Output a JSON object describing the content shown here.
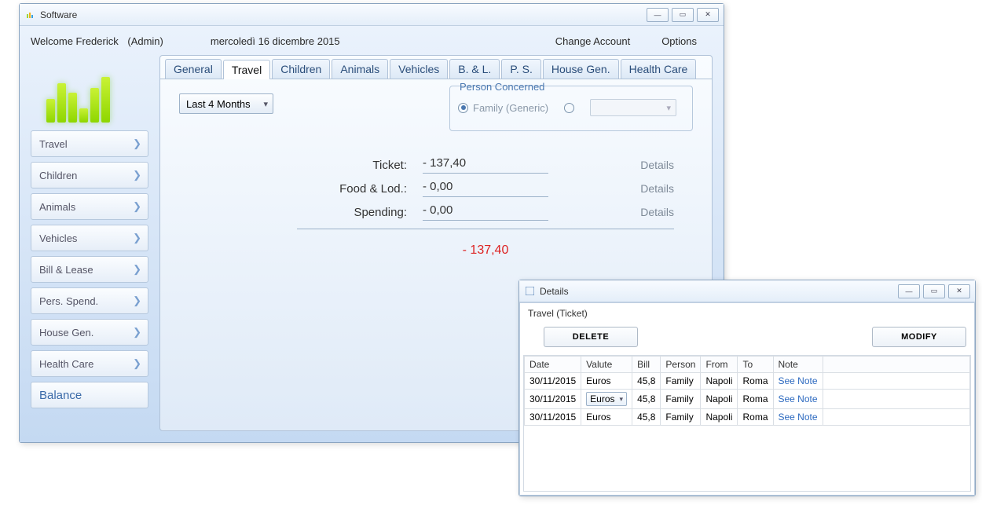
{
  "main_window": {
    "title": "Software",
    "welcome": "Welcome Frederick",
    "role": "(Admin)",
    "date": "mercoledì 16 dicembre 2015",
    "change_account": "Change Account",
    "options": "Options"
  },
  "sidebar": {
    "items": [
      {
        "label": "Travel"
      },
      {
        "label": "Children"
      },
      {
        "label": "Animals"
      },
      {
        "label": "Vehicles"
      },
      {
        "label": "Bill & Lease"
      },
      {
        "label": "Pers. Spend."
      },
      {
        "label": "House Gen."
      },
      {
        "label": "Health Care"
      }
    ],
    "balance": "Balance"
  },
  "tabs": [
    {
      "label": "General"
    },
    {
      "label": "Travel"
    },
    {
      "label": "Children"
    },
    {
      "label": "Animals"
    },
    {
      "label": "Vehicles"
    },
    {
      "label": "B. & L."
    },
    {
      "label": "P. S."
    },
    {
      "label": "House Gen."
    },
    {
      "label": "Health Care"
    }
  ],
  "panel": {
    "period": "Last 4 Months",
    "person_legend": "Person Concerned",
    "radio_family": "Family (Generic)",
    "rows": [
      {
        "label": "Ticket:",
        "amount": "- 137,40",
        "details": "Details"
      },
      {
        "label": "Food & Lod.:",
        "amount": "- 0,00",
        "details": "Details"
      },
      {
        "label": "Spending:",
        "amount": "- 0,00",
        "details": "Details"
      }
    ],
    "total": "- 137,40"
  },
  "details_window": {
    "title": "Details",
    "subtitle": "Travel  (Ticket)",
    "delete": "DELETE",
    "modify": "MODIFY",
    "columns": [
      "Date",
      "Valute",
      "Bill",
      "Person",
      "From",
      "To",
      "Note"
    ],
    "rows": [
      {
        "date": "30/11/2015",
        "valute": "Euros",
        "bill": "45,8",
        "person": "Family",
        "from": "Napoli",
        "to": "Roma",
        "note": "See Note",
        "valute_dd": false
      },
      {
        "date": "30/11/2015",
        "valute": "Euros",
        "bill": "45,8",
        "person": "Family",
        "from": "Napoli",
        "to": "Roma",
        "note": "See Note",
        "valute_dd": true
      },
      {
        "date": "30/11/2015",
        "valute": "Euros",
        "bill": "45,8",
        "person": "Family",
        "from": "Napoli",
        "to": "Roma",
        "note": "See Note",
        "valute_dd": false
      }
    ]
  }
}
